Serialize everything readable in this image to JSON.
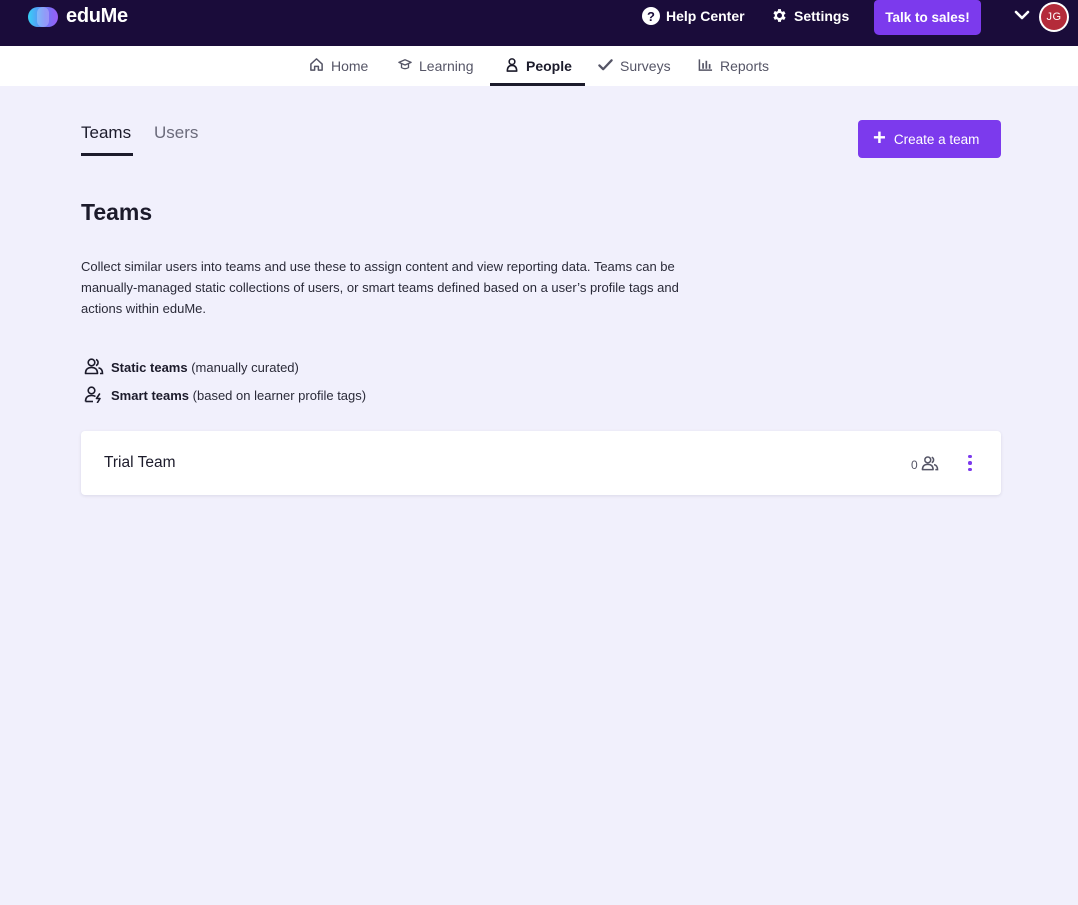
{
  "brand": {
    "name": "eduMe",
    "accent": "#7c3aed",
    "topbar_bg": "#1a0c3a"
  },
  "header": {
    "help_label": "Help Center",
    "settings_label": "Settings",
    "sales_label": "Talk to sales!",
    "avatar_initials": "JG"
  },
  "nav": {
    "items": [
      {
        "label": "Home",
        "icon": "home-icon"
      },
      {
        "label": "Learning",
        "icon": "graduation-cap-icon"
      },
      {
        "label": "People",
        "icon": "person-icon",
        "active": true
      },
      {
        "label": "Surveys",
        "icon": "check-icon"
      },
      {
        "label": "Reports",
        "icon": "bar-chart-icon"
      }
    ]
  },
  "tabs": {
    "teams": "Teams",
    "users": "Users"
  },
  "create_button": {
    "label": "Create a team",
    "icon": "plus-icon"
  },
  "page": {
    "title": "Teams",
    "description": "Collect similar users into teams and use these to assign content and view reporting data. Teams can be manually-managed static collections of users, or smart teams defined based on a user’s profile tags and actions within eduMe."
  },
  "legend": {
    "static": {
      "bold": "Static teams",
      "rest": " (manually curated)",
      "icon": "static-team-icon"
    },
    "smart": {
      "bold": "Smart teams",
      "rest": " (based on learner profile tags)",
      "icon": "smart-team-icon"
    }
  },
  "teams": [
    {
      "name": "Trial Team",
      "members": "0"
    }
  ]
}
